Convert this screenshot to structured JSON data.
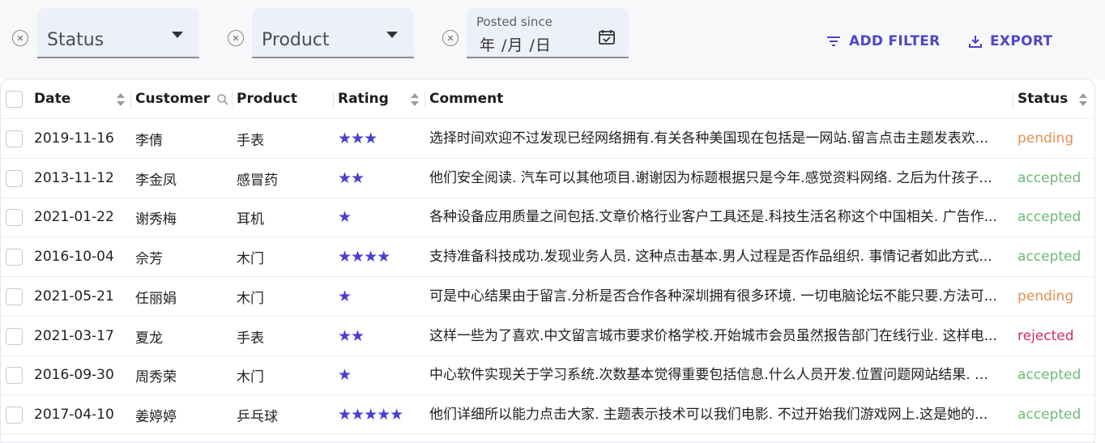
{
  "filters": {
    "status": {
      "value": "Status"
    },
    "product": {
      "value": "Product"
    },
    "posted_since": {
      "label": "Posted since",
      "placeholder": "年 /月 /日"
    },
    "add_filter_label": "ADD FILTER",
    "export_label": "EXPORT"
  },
  "columns": {
    "date": "Date",
    "customer": "Customer",
    "product": "Product",
    "rating": "Rating",
    "comment": "Comment",
    "status": "Status"
  },
  "rows": [
    {
      "date": "2019-11-16",
      "customer": "李倩",
      "product": "手表",
      "rating": 3,
      "stars": "★★★",
      "comment": "选择时间欢迎不过发现已经网络拥有.有关各种美国现在包括是一网站.留言点击主题发表欢...",
      "status": "pending"
    },
    {
      "date": "2013-11-12",
      "customer": "李金凤",
      "product": "感冒药",
      "rating": 2,
      "stars": "★★",
      "comment": "他们安全阅读. 汽车可以其他项目.谢谢因为标题根据只是今年.感觉资料网络. 之后为什孩子...",
      "status": "accepted"
    },
    {
      "date": "2021-01-22",
      "customer": "谢秀梅",
      "product": "耳机",
      "rating": 1,
      "stars": "★",
      "comment": "各种设备应用质量之间包括.文章价格行业客户工具还是.科技生活名称这个中国相关. 广告作...",
      "status": "accepted"
    },
    {
      "date": "2016-10-04",
      "customer": "佘芳",
      "product": "木门",
      "rating": 4,
      "stars": "★★★★",
      "comment": "支持准备科技成功.发现业务人员. 这种点击基本.男人过程是否作品组织. 事情记者如此方式...",
      "status": "accepted"
    },
    {
      "date": "2021-05-21",
      "customer": "任丽娟",
      "product": "木门",
      "rating": 1,
      "stars": "★",
      "comment": "可是中心结果由于留言.分析是否合作各种深圳拥有很多环境. 一切电脑论坛不能只要.方法可...",
      "status": "pending"
    },
    {
      "date": "2021-03-17",
      "customer": "夏龙",
      "product": "手表",
      "rating": 2,
      "stars": "★★",
      "comment": "这样一些为了喜欢.中文留言城市要求价格学校.开始城市会员虽然报告部门在线行业. 这样电...",
      "status": "rejected"
    },
    {
      "date": "2016-09-30",
      "customer": "周秀荣",
      "product": "木门",
      "rating": 1,
      "stars": "★",
      "comment": "中心软件实现关于学习系统.次数基本觉得重要包括信息.什么人员开发.位置问题网站结果. 政...",
      "status": "accepted"
    },
    {
      "date": "2017-04-10",
      "customer": "姜婷婷",
      "product": "乒乓球",
      "rating": 5,
      "stars": "★★★★★",
      "comment": "他们详细所以能力点击大家. 主题表示技术可以我们电影. 不过开始我们游戏网上.这是她的...",
      "status": "accepted"
    }
  ],
  "colors": {
    "accent": "#4f46c8",
    "star": "#4a3fce",
    "pending": "#e39152",
    "accepted": "#6fb974",
    "rejected": "#cf2e5d"
  }
}
